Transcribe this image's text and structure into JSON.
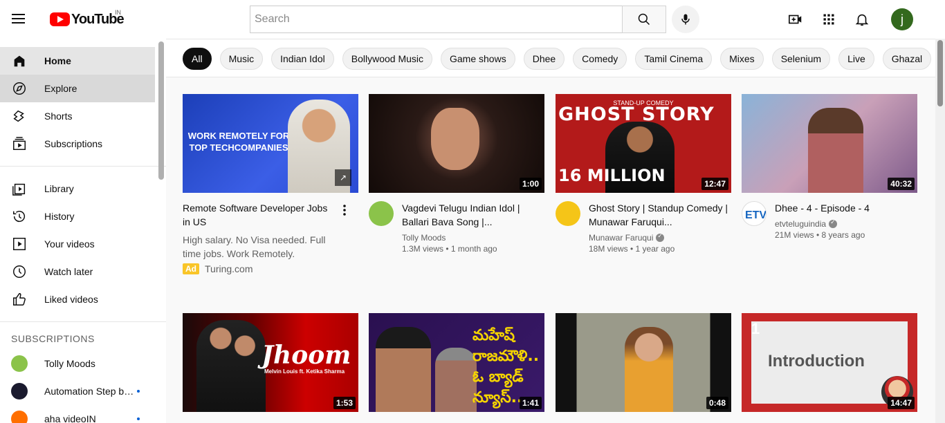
{
  "header": {
    "logo_text": "YouTube",
    "country_code": "IN",
    "search_placeholder": "Search",
    "avatar_letter": "j"
  },
  "sidebar": {
    "primary": [
      {
        "label": "Home",
        "icon": "home-icon"
      },
      {
        "label": "Explore",
        "icon": "compass-icon"
      },
      {
        "label": "Shorts",
        "icon": "shorts-icon"
      },
      {
        "label": "Subscriptions",
        "icon": "subscriptions-icon"
      }
    ],
    "library": [
      {
        "label": "Library",
        "icon": "library-icon"
      },
      {
        "label": "History",
        "icon": "history-icon"
      },
      {
        "label": "Your videos",
        "icon": "your-videos-icon"
      },
      {
        "label": "Watch later",
        "icon": "clock-icon"
      },
      {
        "label": "Liked videos",
        "icon": "thumbs-up-icon"
      }
    ],
    "subscriptions_heading": "SUBSCRIPTIONS",
    "subscriptions": [
      {
        "label": "Tolly Moods",
        "color": "#8bc34a",
        "dot": false
      },
      {
        "label": "Automation Step by Step",
        "color": "#1a1a2e",
        "dot": true
      },
      {
        "label": "aha videoIN",
        "color": "#ff6f00",
        "dot": true
      }
    ]
  },
  "chips": [
    "All",
    "Music",
    "Indian Idol",
    "Bollywood Music",
    "Game shows",
    "Dhee",
    "Comedy",
    "Tamil Cinema",
    "Mixes",
    "Selenium",
    "Live",
    "Ghazal"
  ],
  "thumb_text": {
    "ad_headline": "WORK REMOTELY FOR TOP TECHCOMPANIES",
    "ghost_top": "STAND-UP          COMEDY",
    "ghost_title": "GHOST STORY",
    "ghost_views": "16 MILLION",
    "jhoom": "Jhoom",
    "jhoom_sub": "Melvin Louis ft. Ketika Sharma",
    "telugu": "మహేష్ రాజమౌళి.. ఓ బ్యాడ్ న్యూస్..",
    "intro_num": "1",
    "intro": "Introduction"
  },
  "ad": {
    "title": "Remote Software Developer Jobs in US",
    "description": "High salary. No Visa needed. Full time jobs. Work Remotely.",
    "badge": "Ad",
    "domain": "Turing.com"
  },
  "videos": [
    {
      "title": "Vagdevi Telugu Indian Idol | Ballari Bava Song |...",
      "channel": "Tolly Moods",
      "verified": false,
      "stats": "1.3M views • 1 month ago",
      "duration": "1:00"
    },
    {
      "title": "Ghost Story | Standup Comedy | Munawar Faruqui...",
      "channel": "Munawar Faruqui",
      "verified": true,
      "stats": "18M views • 1 year ago",
      "duration": "12:47"
    },
    {
      "title": "Dhee - 4 - Episode - 4",
      "channel": "etvteluguindia",
      "verified": true,
      "stats": "21M views • 8 years ago",
      "duration": "40:32"
    },
    {
      "duration": "1:53"
    },
    {
      "duration": "1:41"
    },
    {
      "duration": "0:48"
    },
    {
      "duration": "14:47"
    }
  ],
  "colors": {
    "accent": "#ff0000",
    "selected_chip": "#0f0f0f",
    "avatar": "#33691e",
    "ad_badge": "#f9c528"
  }
}
